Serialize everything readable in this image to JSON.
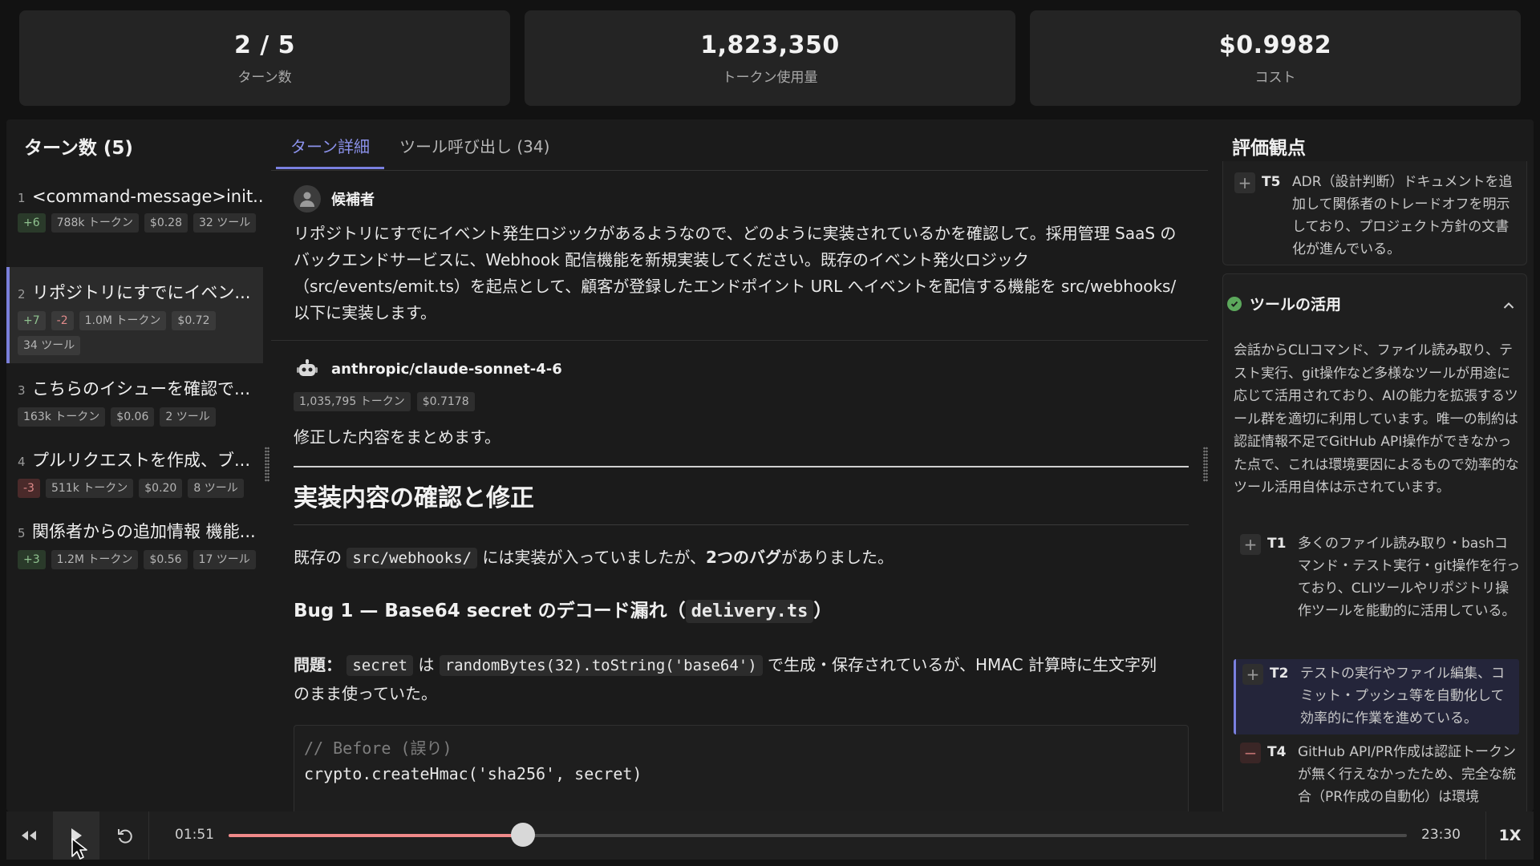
{
  "stats": [
    {
      "value": "2 / 5",
      "label": "ターン数"
    },
    {
      "value": "1,823,350",
      "label": "トークン使用量"
    },
    {
      "value": "$0.9982",
      "label": "コスト"
    }
  ],
  "sidebar": {
    "title": "ターン数 (5)",
    "turns": [
      {
        "num": "1",
        "title": "<command-message>init...",
        "tags": [
          "+6",
          "788k トークン",
          "$0.28",
          "32 ツール"
        ]
      },
      {
        "num": "2",
        "title": "リポジトリにすでにイベン...",
        "tags": [
          "+7",
          "-2",
          "1.0M トークン",
          "$0.72",
          "34 ツール"
        ]
      },
      {
        "num": "3",
        "title": "こちらのイシューを確認で...",
        "tags": [
          "163k トークン",
          "$0.06",
          "2 ツール"
        ]
      },
      {
        "num": "4",
        "title": "プルリクエストを作成、ブ...",
        "tags": [
          "-3",
          "511k トークン",
          "$0.20",
          "8 ツール"
        ]
      },
      {
        "num": "5",
        "title": "関係者からの追加情報 機能...",
        "tags": [
          "+3",
          "1.2M トークン",
          "$0.56",
          "17 ツール"
        ]
      }
    ]
  },
  "tabs": {
    "detail": "ターン詳細",
    "tools": "ツール呼び出し (34)"
  },
  "prompt": {
    "author": "候補者",
    "text": "リポジトリにすでにイベント発生ロジックがあるようなので、どのように実装されているかを確認して。採用管理 SaaS のバックエンドサービスに、Webhook 配信機能を新規実装してください。既存のイベント発火ロジック（src/events/emit.ts）を起点として、顧客が登録したエンドポイント URL へイベントを配信する機能を src/webhooks/ 以下に実装します。"
  },
  "response": {
    "author": "anthropic/claude-sonnet-4-6",
    "tokens": "1,035,795 トークン",
    "cost": "$0.7178",
    "intro": "修正した内容をまとめます。",
    "heading": "実装内容の確認と修正",
    "p1_before": "既存の ",
    "p1_code": "src/webhooks/",
    "p1_mid": " には実装が入っていましたが、",
    "p1_bold": "2つのバグ",
    "p1_after": "がありました。",
    "bug_title_before": "Bug 1 — Base64 secret のデコード漏れ（",
    "bug_title_code": "delivery.ts",
    "bug_title_after": "）",
    "p2_label": "問題：",
    "p2_code1": "secret",
    "p2_mid1": " は ",
    "p2_code2": "randomBytes(32).toString('base64')",
    "p2_after": " で生成・保存されているが、HMAC 計算時に生文字列",
    "p2_line2": "のまま使っていた。",
    "code_comment": "// Before (誤り)",
    "code_line": "crypto.createHmac('sha256', secret)"
  },
  "right": {
    "title": "評価観点",
    "t5": {
      "id": "T5",
      "text": "ADR（設計判断）ドキュメントを追加して関係者のトレードオフを明示しており、プロジェクト方針の文書化が進んでいる。"
    },
    "section_title": "ツールの活用",
    "section_desc": "会話からCLIコマンド、ファイル読み取り、テスト実行、git操作など多様なツールが用途に応じて活用されており、AIの能力を拡張するツール群を適切に利用しています。唯一の制約は認証情報不足でGitHub API操作ができなかった点で、これは環境要因によるもので効率的なツール活用自体は示されています。",
    "t1": {
      "id": "T1",
      "text": "多くのファイル読み取り・bashコマンド・テスト実行・git操作を行っており、CLIツールやリポジトリ操作ツールを能動的に活用している。"
    },
    "t2": {
      "id": "T2",
      "text": "テストの実行やファイル編集、コミット・プッシュ等を自動化して効率的に作業を進めている。"
    },
    "t4": {
      "id": "T4",
      "text": "GitHub API/PR作成は認証トークンが無く行えなかったため、完全な統合（PR作成の自動化）は環境"
    }
  },
  "player": {
    "current": "01:51",
    "total": "23:30",
    "speed": "1X",
    "progress": 0.25
  },
  "colors": {
    "accent": "#7a80e0",
    "progress": "#f08a8a",
    "positive": "#8fc28f",
    "negative": "#e08a8a"
  }
}
